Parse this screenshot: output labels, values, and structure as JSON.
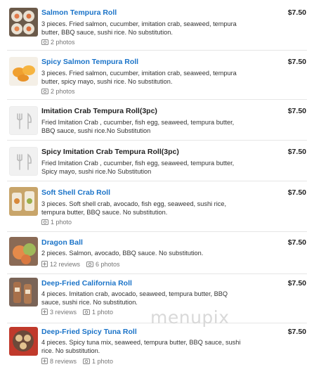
{
  "menu": {
    "items": [
      {
        "name": "Salmon Tempura Roll",
        "price": "$7.50",
        "description": "3 pieces. Fried salmon, cucumber, imitation crab, seaweed, tempura butter, BBQ sauce, sushi rice. No substitution.",
        "reviews": "",
        "photos": "2 photos",
        "thumb": "photo-salmon-roll",
        "link": true
      },
      {
        "name": "Spicy Salmon Tempura Roll",
        "price": "$7.50",
        "description": "3 pieces. Fried salmon, cucumber, imitation crab, seaweed, tempura butter, spicy mayo, sushi rice. No substitution.",
        "reviews": "",
        "photos": "2 photos",
        "thumb": "photo-spicy-salmon",
        "link": true
      },
      {
        "name": "Imitation Crab Tempura Roll(3pc)",
        "price": "$7.50",
        "description": "Fried Imitation Crab , cucumber, fish egg, seaweed, tempura butter, BBQ sauce, sushi rice.No Substitution",
        "reviews": "",
        "photos": "",
        "thumb": "utensils-placeholder",
        "link": false
      },
      {
        "name": "Spicy Imitation Crab Tempura Roll(3pc)",
        "price": "$7.50",
        "description": "Fried Imitation Crab , cucumber, fish egg, seaweed, tempura butter, Spicy mayo, sushi rice.No Substitution",
        "reviews": "",
        "photos": "",
        "thumb": "utensils-placeholder",
        "link": false
      },
      {
        "name": "Soft Shell Crab Roll",
        "price": "$7.50",
        "description": "3 pieces. Soft shell crab, avocado, fish egg, seaweed, sushi rice, tempura butter, BBQ sauce. No substitution.",
        "reviews": "",
        "photos": "1 photo",
        "thumb": "photo-soft-shell",
        "link": true
      },
      {
        "name": "Dragon Ball",
        "price": "$7.50",
        "description": "2 pieces. Salmon, avocado, BBQ sauce. No substitution.",
        "reviews": "12 reviews",
        "photos": "6 photos",
        "thumb": "photo-dragon-ball",
        "link": true
      },
      {
        "name": "Deep-Fried California Roll",
        "price": "$7.50",
        "description": "4 pieces. Imitation crab, avocado, seaweed, tempura butter, BBQ sauce, sushi rice. No substitution.",
        "reviews": "3 reviews",
        "photos": "1 photo",
        "thumb": "photo-deep-fried-ca",
        "link": true
      },
      {
        "name": "Deep-Fried Spicy Tuna Roll",
        "price": "$7.50",
        "description": "4 pieces. Spicy tuna mix, seaweed, tempura butter, BBQ sauce, sushi rice. No substitution.",
        "reviews": "8 reviews",
        "photos": "1 photo",
        "thumb": "photo-spicy-tuna",
        "link": true
      }
    ]
  },
  "watermark": "menupix",
  "colors": {
    "link": "#1a73c8",
    "text": "#222222",
    "meta": "#777777",
    "divider": "#e6e6e6"
  }
}
